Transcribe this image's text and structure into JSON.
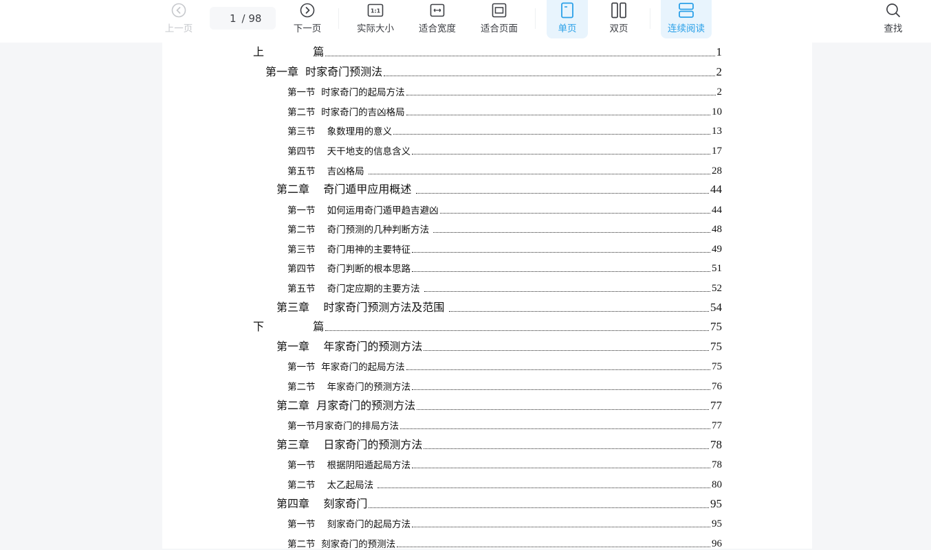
{
  "toolbar": {
    "prev_page": {
      "label": "上一页",
      "icon": "chevron-left-circle-icon",
      "disabled": true
    },
    "page_indicator": {
      "current": "1",
      "total": "/ 98"
    },
    "next_page": {
      "label": "下一页",
      "icon": "chevron-right-circle-icon"
    },
    "actual_size": {
      "label": "实际大小",
      "icon": "one-to-one-icon",
      "glyph": "1:1"
    },
    "fit_width": {
      "label": "适合宽度",
      "icon": "fit-width-icon"
    },
    "fit_page": {
      "label": "适合页面",
      "icon": "fit-page-icon"
    },
    "single_page": {
      "label": "单页",
      "icon": "single-page-icon",
      "active": true
    },
    "double_page": {
      "label": "双页",
      "icon": "double-page-icon"
    },
    "continuous": {
      "label": "连续阅读",
      "icon": "continuous-read-icon",
      "active": true
    },
    "find": {
      "label": "查找",
      "icon": "search-icon"
    },
    "accent_color": "#2aa0e8",
    "active_bg": "#e8f4fd"
  },
  "toc": [
    {
      "level": "part",
      "text": "上              篇",
      "page": "1"
    },
    {
      "level": "chap1",
      "text": "第一章  时家奇门预测法",
      "page": "2"
    },
    {
      "level": "sec",
      "text": "第一节  时家奇门的起局方法",
      "page": "2"
    },
    {
      "level": "sec",
      "text": "第二节  时家奇门的吉凶格局",
      "page": "10"
    },
    {
      "level": "sec",
      "text": "第三节    象数理用的意义",
      "page": "13"
    },
    {
      "level": "sec",
      "text": "第四节    天干地支的信息含义",
      "page": "17"
    },
    {
      "level": "sec",
      "text": "第五节    吉凶格局 ",
      "page": "28"
    },
    {
      "level": "chap",
      "text": "第二章    奇门遁甲应用概述 ",
      "page": "44"
    },
    {
      "level": "sec",
      "text": "第一节    如何运用奇门遁甲趋吉避凶",
      "page": "44"
    },
    {
      "level": "sec",
      "text": "第二节    奇门预测的几种判断方法 ",
      "page": "48"
    },
    {
      "level": "sec",
      "text": "第三节    奇门用神的主要特征",
      "page": "49"
    },
    {
      "level": "sec",
      "text": "第四节    奇门判断的根本思路",
      "page": "51"
    },
    {
      "level": "sec",
      "text": "第五节    奇门定应期的主要方法 ",
      "page": "52"
    },
    {
      "level": "chap",
      "text": "第三章    时家奇门预测方法及范围 ",
      "page": "54"
    },
    {
      "level": "part",
      "text": "下              篇",
      "page": "75"
    },
    {
      "level": "chap",
      "text": "第一章    年家奇门的预测方法",
      "page": "75"
    },
    {
      "level": "sec",
      "text": "第一节  年家奇门的起局方法",
      "page": "75"
    },
    {
      "level": "sec",
      "text": "第二节    年家奇门的预测方法",
      "page": "76"
    },
    {
      "level": "chap",
      "text": "第二章  月家奇门的预测方法",
      "page": "77"
    },
    {
      "level": "sec",
      "text": "第一节月家奇门的排局方法",
      "page": "77"
    },
    {
      "level": "chap",
      "text": "第三章    日家奇门的预测方法",
      "page": "78"
    },
    {
      "level": "sec",
      "text": "第一节    根据阴阳遁起局方法",
      "page": "78"
    },
    {
      "level": "sec",
      "text": "第二节    太乙起局法 ",
      "page": "80"
    },
    {
      "level": "chap",
      "text": "第四章    刻家奇门",
      "page": "95"
    },
    {
      "level": "sec",
      "text": "第一节    刻家奇门的起局方法",
      "page": "95"
    },
    {
      "level": "sec",
      "text": "第二节  刻家奇门的预测法",
      "page": "96"
    }
  ]
}
